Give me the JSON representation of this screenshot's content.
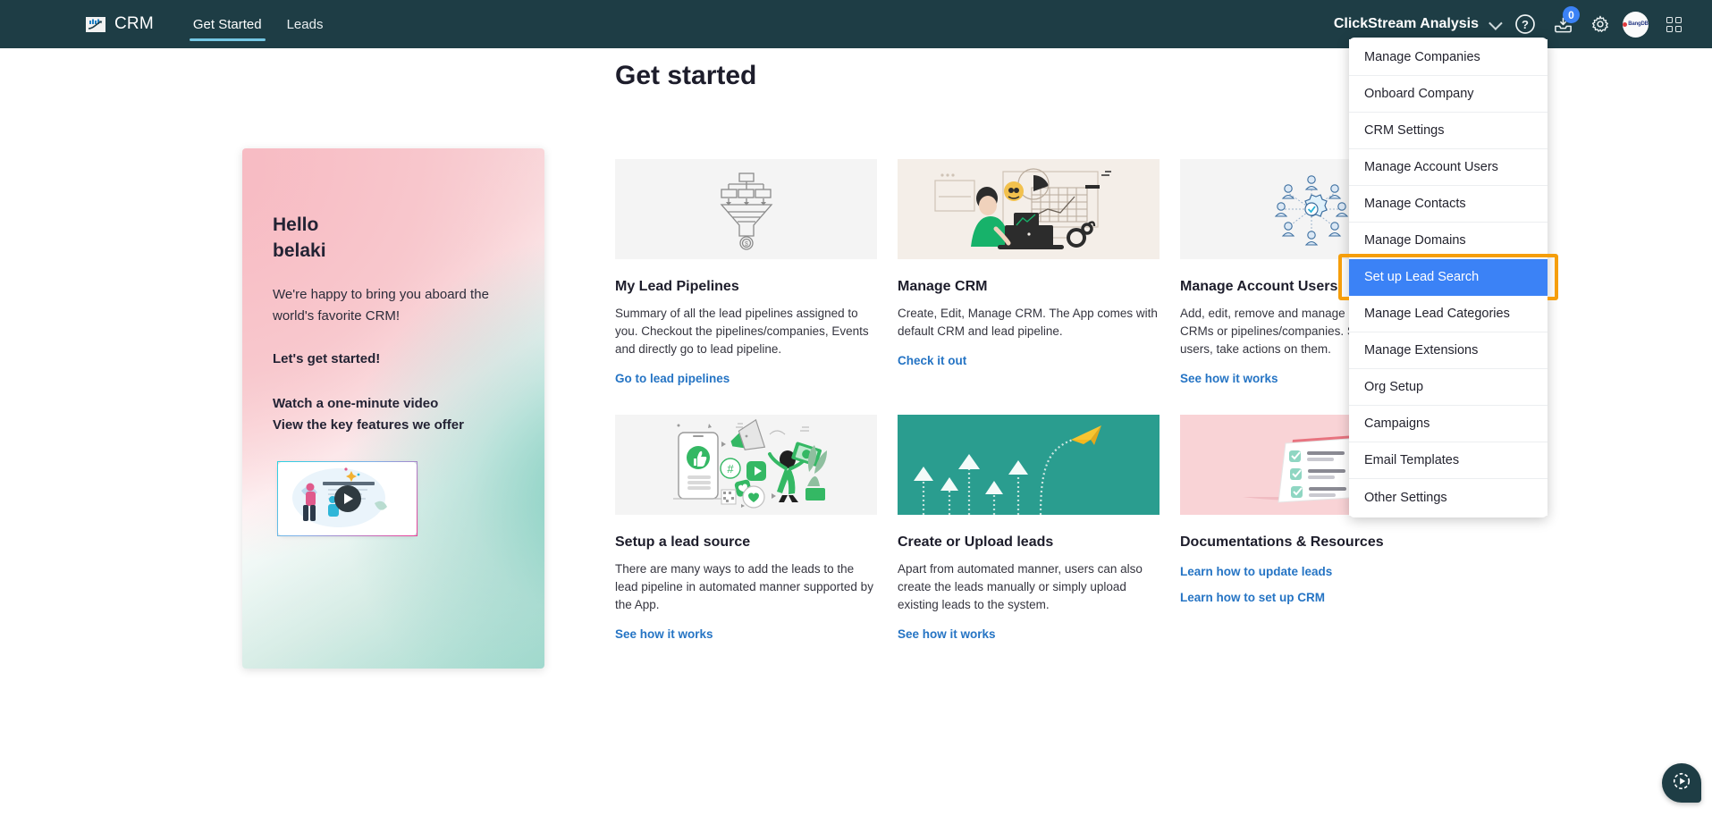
{
  "topbar": {
    "brand_name": "CRM",
    "brand_logo_icon": "crm-chart-logo-icon",
    "nav": [
      {
        "label": "Get Started",
        "active": true
      },
      {
        "label": "Leads",
        "active": false
      }
    ],
    "org_selector": {
      "label": "ClickStream Analysis",
      "chevron_icon": "chevron-down-icon"
    },
    "help_icon": "help-circle-icon",
    "inbox_icon": "inbox-download-icon",
    "inbox_badge_count": "0",
    "settings_icon": "gear-icon",
    "avatar_label": "BangDB",
    "apps_icon": "apps-grid-icon",
    "background_color": "#1e3d45",
    "active_tab_underline_color": "#74c7e3"
  },
  "page": {
    "title": "Get started"
  },
  "welcome_card": {
    "greeting_line1": "Hello",
    "greeting_line2": "belaki",
    "body": "We're happy to bring you aboard the world's favorite CRM!",
    "cta": "Let's get started!",
    "links": [
      "Watch a one-minute video",
      "View the key features we offer"
    ],
    "video_thumb_icon": "play-button-icon",
    "gradient_colors": [
      "#f7c0c8",
      "#ffffff",
      "#8fd3c4"
    ]
  },
  "cards": [
    {
      "title": "My Lead Pipelines",
      "description": "Summary of all the lead pipelines assigned to you. Checkout the pipelines/companies, Events and directly go to lead pipeline.",
      "links": [
        "Go to lead pipelines"
      ],
      "image_icon": "funnel-pipeline-illustration",
      "image_bg": "#f4f4f4"
    },
    {
      "title": "Manage CRM",
      "description": "Create, Edit, Manage CRM. The App comes with default CRM and lead pipeline.",
      "links": [
        "Check it out"
      ],
      "image_icon": "person-at-desk-analytics-illustration",
      "image_bg": "#f4eee8"
    },
    {
      "title": "Manage Account Users",
      "description": "Add, edit, remove and manage users for the CRMs or pipelines/companies. See list of all users, take actions on them.",
      "links": [
        "See how it works"
      ],
      "image_icon": "users-network-gear-illustration",
      "image_bg": "#f4f4f4"
    },
    {
      "title": "Setup a lead source",
      "description": "There are many ways to add the leads to the lead pipeline in automated manner supported by the App.",
      "links": [
        "See how it works"
      ],
      "image_icon": "social-media-marketing-illustration",
      "image_bg": "#f4f4f4"
    },
    {
      "title": "Create or Upload leads",
      "description": "Apart from automated manner, users can also create the leads manually or simply upload existing leads to the system.",
      "links": [
        "See how it works"
      ],
      "image_icon": "paper-plane-arrows-illustration",
      "image_bg": "#2a9d8f"
    },
    {
      "title": "Documentations & Resources",
      "description": "",
      "links": [
        "Learn how to update leads",
        "Learn how to set up CRM"
      ],
      "image_icon": "checklist-notepad-illustration",
      "image_bg": "#f9d3d6"
    }
  ],
  "dropdown_menu": {
    "items": [
      {
        "label": "Manage Companies",
        "selected": false
      },
      {
        "label": "Onboard Company",
        "selected": false
      },
      {
        "label": "CRM Settings",
        "selected": false
      },
      {
        "label": "Manage Account Users",
        "selected": false
      },
      {
        "label": "Manage Contacts",
        "selected": false
      },
      {
        "label": "Manage Domains",
        "selected": false
      },
      {
        "label": "Set up Lead Search",
        "selected": true
      },
      {
        "label": "Manage Lead Categories",
        "selected": false
      },
      {
        "label": "Manage Extensions",
        "selected": false
      },
      {
        "label": "Org Setup",
        "selected": false
      },
      {
        "label": "Campaigns",
        "selected": false
      },
      {
        "label": "Email Templates",
        "selected": false
      },
      {
        "label": "Other Settings",
        "selected": false
      }
    ],
    "selected_bg_color": "#3b82f6",
    "highlight_border_color": "#f59e0b"
  },
  "fab": {
    "icon": "play-tour-icon",
    "color": "#1e3d45"
  }
}
